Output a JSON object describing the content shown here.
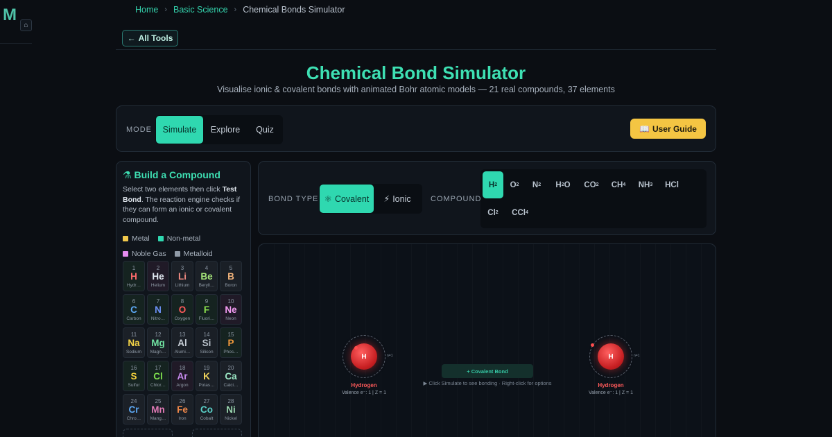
{
  "logo": {
    "letter": "M",
    "home_icon": "home-icon"
  },
  "breadcrumb": {
    "home": "Home",
    "category": "Basic Science",
    "current": "Chemical Bonds Simulator"
  },
  "back_button": {
    "arrow": "←",
    "label": "All Tools"
  },
  "header": {
    "title": "Chemical Bond Simulator",
    "subtitle": "Visualise ionic & covalent bonds with animated Bohr atomic models — 21 real compounds, 37 elements"
  },
  "mode": {
    "label": "MODE",
    "tabs": [
      {
        "label": "Simulate",
        "active": true
      },
      {
        "label": "Explore",
        "active": false
      },
      {
        "label": "Quiz",
        "active": false
      }
    ],
    "guide_icon": "📖",
    "guide_label": "User Guide"
  },
  "builder": {
    "title_icon": "⚗",
    "title": "Build a Compound",
    "desc_pre": "Select two elements then click ",
    "desc_bold1": "Test Bond",
    "desc_post": ". The reaction engine checks if they can form an ionic or covalent compound.",
    "legend": [
      {
        "label": "Metal",
        "color": "#f2c94c"
      },
      {
        "label": "Non-metal",
        "color": "#2fd8b0"
      },
      {
        "label": "Noble Gas",
        "color": "#e58cf0"
      },
      {
        "label": "Metalloid",
        "color": "#8f9aa6"
      }
    ],
    "elements": [
      {
        "num": "1",
        "sym": "H",
        "name": "Hydr…",
        "cls": "nonmetal",
        "color": "#ff6b6b"
      },
      {
        "num": "2",
        "sym": "He",
        "name": "Helium",
        "cls": "noble",
        "color": "#dfe7ef"
      },
      {
        "num": "3",
        "sym": "Li",
        "name": "Lithium",
        "cls": "metal",
        "color": "#f28b82"
      },
      {
        "num": "4",
        "sym": "Be",
        "name": "Beryll…",
        "cls": "metal",
        "color": "#a5e47a"
      },
      {
        "num": "5",
        "sym": "B",
        "name": "Boron",
        "cls": "metalloid",
        "color": "#f0b27a"
      },
      {
        "num": "6",
        "sym": "C",
        "name": "Carbon",
        "cls": "nonmetal",
        "color": "#5da9f5"
      },
      {
        "num": "7",
        "sym": "N",
        "name": "Nitro…",
        "cls": "nonmetal",
        "color": "#6b8ff2"
      },
      {
        "num": "8",
        "sym": "O",
        "name": "Oxygen",
        "cls": "nonmetal",
        "color": "#ff5a5a"
      },
      {
        "num": "9",
        "sym": "F",
        "name": "Fluori…",
        "cls": "nonmetal",
        "color": "#8be04e"
      },
      {
        "num": "10",
        "sym": "Ne",
        "name": "Neon",
        "cls": "noble",
        "color": "#f39bf2"
      },
      {
        "num": "11",
        "sym": "Na",
        "name": "Sodium",
        "cls": "metal",
        "color": "#f5d547"
      },
      {
        "num": "12",
        "sym": "Mg",
        "name": "Magn…",
        "cls": "metal",
        "color": "#6fe0a0"
      },
      {
        "num": "13",
        "sym": "Al",
        "name": "Alumi…",
        "cls": "metal",
        "color": "#c7ced6"
      },
      {
        "num": "14",
        "sym": "Si",
        "name": "Silicon",
        "cls": "metalloid",
        "color": "#b8c0c9"
      },
      {
        "num": "15",
        "sym": "P",
        "name": "Phos…",
        "cls": "nonmetal",
        "color": "#f39a3c"
      },
      {
        "num": "16",
        "sym": "S",
        "name": "Sulfur",
        "cls": "nonmetal",
        "color": "#f5d23c"
      },
      {
        "num": "17",
        "sym": "Cl",
        "name": "Chlor…",
        "cls": "nonmetal",
        "color": "#7ee04e"
      },
      {
        "num": "18",
        "sym": "Ar",
        "name": "Argon",
        "cls": "noble",
        "color": "#c98bf0"
      },
      {
        "num": "19",
        "sym": "K",
        "name": "Potas…",
        "cls": "metal",
        "color": "#f2d55c"
      },
      {
        "num": "20",
        "sym": "Ca",
        "name": "Calci…",
        "cls": "metal",
        "color": "#9be7c4"
      },
      {
        "num": "24",
        "sym": "Cr",
        "name": "Chro…",
        "cls": "metal",
        "color": "#5da9f5"
      },
      {
        "num": "25",
        "sym": "Mn",
        "name": "Mang…",
        "cls": "metal",
        "color": "#e07ab5"
      },
      {
        "num": "26",
        "sym": "Fe",
        "name": "Iron",
        "cls": "metal",
        "color": "#f0884a"
      },
      {
        "num": "27",
        "sym": "Co",
        "name": "Cobalt",
        "cls": "metal",
        "color": "#5ad0c8"
      },
      {
        "num": "28",
        "sym": "Ni",
        "name": "Nickel",
        "cls": "metal",
        "color": "#9ad6ae"
      }
    ]
  },
  "bond": {
    "label": "BOND TYPE",
    "tabs": [
      {
        "icon": "⚛",
        "label": "Covalent",
        "active": true
      },
      {
        "icon": "⚡",
        "label": "Ionic",
        "active": false
      }
    ],
    "compound_label": "COMPOUND",
    "compounds": [
      {
        "base": "H",
        "sub": "2",
        "active": true
      },
      {
        "base": "O",
        "sub": "2",
        "active": false
      },
      {
        "base": "N",
        "sub": "2",
        "active": false
      },
      {
        "base": "H",
        "sub": "2",
        "tail": "O",
        "active": false
      },
      {
        "base": "CO",
        "sub": "2",
        "active": false
      },
      {
        "base": "CH",
        "sub": "4",
        "active": false
      },
      {
        "base": "NH",
        "sub": "3",
        "active": false
      },
      {
        "base": "HCl",
        "sub": "",
        "active": false
      },
      {
        "base": "Cl",
        "sub": "2",
        "active": false
      },
      {
        "base": "CCl",
        "sub": "4",
        "active": false
      }
    ]
  },
  "stage": {
    "atom_left": {
      "symbol": "H",
      "name": "Hydrogen",
      "info": "Valence e⁻: 1  |  Z = 1",
      "shell": "n=1"
    },
    "atom_right": {
      "symbol": "H",
      "name": "Hydrogen",
      "info": "Valence e⁻: 1  |  Z = 1",
      "shell": "n=1"
    },
    "bond_label": "+ Covalent Bond",
    "hint": "▶ Click Simulate to see bonding  ·  Right-click for options"
  }
}
